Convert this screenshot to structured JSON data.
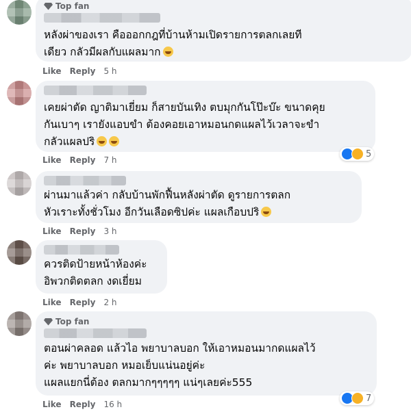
{
  "badge": {
    "top_fan": "Top fan"
  },
  "actions": {
    "like": "Like",
    "reply": "Reply"
  },
  "comments": [
    {
      "top_fan": true,
      "text": "หลังผ่าของเรา คือออกกฎที่บ้านห้ามเปิดรายการตลกเลยที\nเดียว กลัวมีผลกับแผลมาก",
      "emoji": "grin",
      "time": "5 h"
    },
    {
      "top_fan": false,
      "text": "เคยผ่าตัด ญาติมาเยี่ยม ก็สายบันเทิง ตบมุกกันโป๊ะบ๊ะ ขนาดคุย\nกันเบาๆ เรายังแอบขำ ต้องคอยเอาหมอนกดแผลไว้เวลาจะขำ\nกลัวแผลปริ",
      "emoji": "laugh-tears",
      "time": "7 h",
      "reaction_count": "5"
    },
    {
      "top_fan": false,
      "text": "ผ่านมาแล้วค่า กลับบ้านพักฟื้นหลังผ่าตัด ดูรายการตลก\nหัวเราะทั้งชั่วโมง อีกวันเลือดซิปค่ะ แผลเกือบปริ",
      "emoji": "grin",
      "time": "3 h"
    },
    {
      "top_fan": false,
      "text": "ควรติดป้ายหน้าห้องค่ะ\nอิพวกติดตลก งดเยี่ยม",
      "time": "2 h"
    },
    {
      "top_fan": true,
      "text": "ตอนผ่าคลอด แล้วไอ พยาบาลบอก ให้เอาหมอนมากดแผลไว้\nค่ะ พยาบาลบอก หมอเย็บแน่นอยู่ค่ะ\nแผลแยกนี่ต้อง ตลกมากๆๆๆๆๆ แน่ๆเลยค่ะ555",
      "time": "16 h",
      "reaction_count": "7"
    }
  ],
  "colors": {
    "bubble": "#f0f2f5",
    "meta": "#65676b",
    "like": "#1877f2",
    "haha": "#f7b125"
  },
  "icons": [
    "top-fan-diamond-icon",
    "like-reaction-icon",
    "haha-reaction-icon",
    "emoji-icon"
  ]
}
